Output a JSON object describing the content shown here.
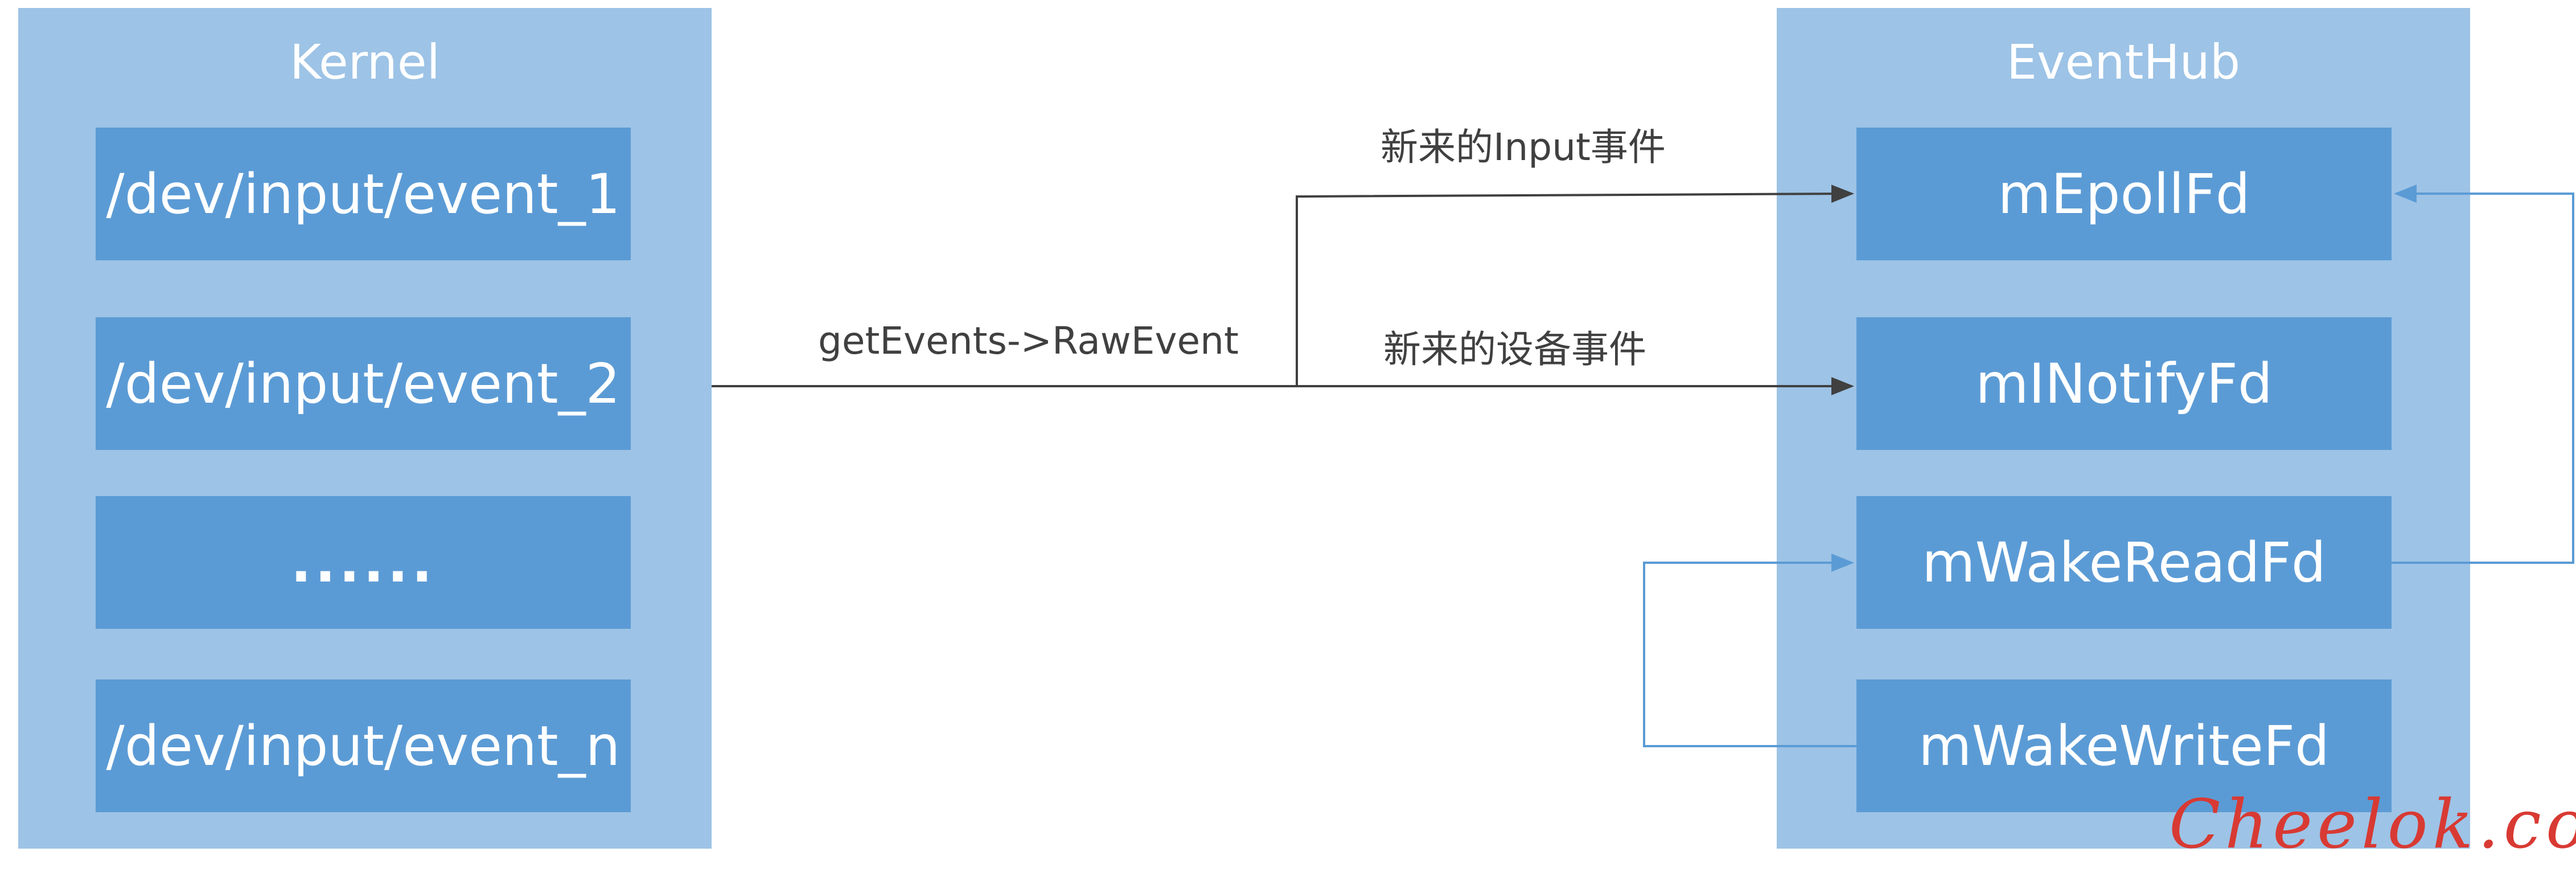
{
  "kernel": {
    "title": "Kernel",
    "devices": [
      "/dev/input/event_1",
      "/dev/input/event_2",
      "......",
      "/dev/input/event_n"
    ]
  },
  "eventhub": {
    "title": "EventHub",
    "fds": [
      "mEpollFd",
      "mINotifyFd",
      "mWakeReadFd",
      "mWakeWriteFd"
    ]
  },
  "labels": {
    "get_events": "getEvents->RawEvent",
    "new_input": "新来的Input事件",
    "new_device": "新来的设备事件"
  },
  "watermark": "Cheelok.com",
  "colors": {
    "panel": "#9dc3e6",
    "box": "#5b9bd5",
    "dark_arrow": "#404040",
    "blue_arrow": "#5b9bd5",
    "watermark": "#d83a33"
  }
}
